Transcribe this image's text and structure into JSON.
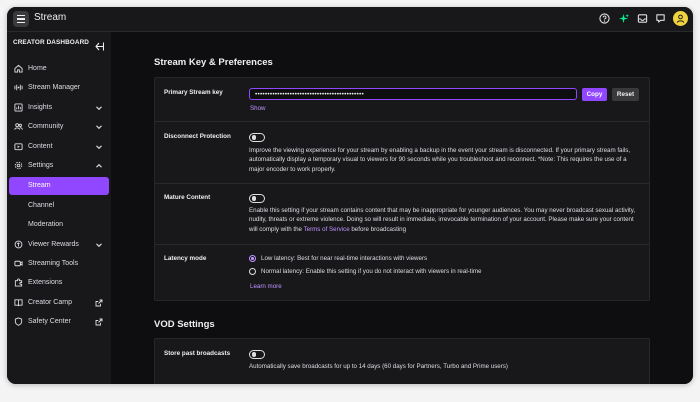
{
  "app": {
    "title": "Stream"
  },
  "topbar": {
    "icons": [
      "help-icon",
      "sparkle-icon",
      "inbox-icon",
      "whispers-icon"
    ],
    "avatar": "avatar-icon"
  },
  "sidebar": {
    "header": "CREATOR DASHBOARD",
    "items": [
      {
        "label": "Home",
        "icon": "home-icon"
      },
      {
        "label": "Stream Manager",
        "icon": "stream-manager-icon"
      },
      {
        "label": "Insights",
        "icon": "insights-icon"
      },
      {
        "label": "Community",
        "icon": "community-icon"
      },
      {
        "label": "Content",
        "icon": "content-icon"
      },
      {
        "label": "Settings",
        "icon": "gear-icon"
      },
      {
        "label": "Stream"
      },
      {
        "label": "Channel"
      },
      {
        "label": "Moderation"
      },
      {
        "label": "Viewer Rewards",
        "icon": "rewards-icon"
      },
      {
        "label": "Streaming Tools",
        "icon": "streaming-tools-icon"
      },
      {
        "label": "Extensions",
        "icon": "extensions-icon"
      },
      {
        "label": "Creator Camp",
        "icon": "creator-camp-icon"
      },
      {
        "label": "Safety Center",
        "icon": "safety-center-icon"
      }
    ]
  },
  "stream_key_section": {
    "title": "Stream Key & Preferences",
    "primary_key": {
      "label": "Primary Stream key",
      "value": "••••••••••••••••••••••••••••••••••••••••••••",
      "copy_label": "Copy",
      "reset_label": "Reset",
      "show_label": "Show"
    },
    "disconnect": {
      "label": "Disconnect Protection",
      "description": "Improve the viewing experience for your stream by enabling a backup in the event your stream is disconnected. If your primary stream fails, automatically display a temporary visual to viewers for 90 seconds while you troubleshoot and reconnect. *Note: This requires the use of a major encoder to work properly."
    },
    "mature": {
      "label": "Mature Content",
      "description_before": "Enable this setting if your stream contains content that may be inappropriate for younger audiences. You may never broadcast sexual activity, nudity, threats or extreme violence. Doing so will result in immediate, irrevocable termination of your account. Please make sure your content will comply with the ",
      "terms_link": "Terms of Service",
      "description_after": " before broadcasting"
    },
    "latency": {
      "label": "Latency mode",
      "options": [
        "Low latency: Best for near real-time interactions with viewers",
        "Normal latency: Enable this setting if you do not interact with viewers in real-time"
      ],
      "selected_index": 0,
      "learn_more": "Learn more"
    }
  },
  "vod_section": {
    "title": "VOD Settings",
    "store_past": {
      "label": "Store past broadcasts",
      "description": "Automatically save broadcasts for up to 14 days (60 days for Partners, Turbo and Prime users)"
    }
  },
  "colors": {
    "accent": "#9147ff",
    "link": "#bf94ff",
    "background": "#0e0e10",
    "panel": "#18181b"
  }
}
